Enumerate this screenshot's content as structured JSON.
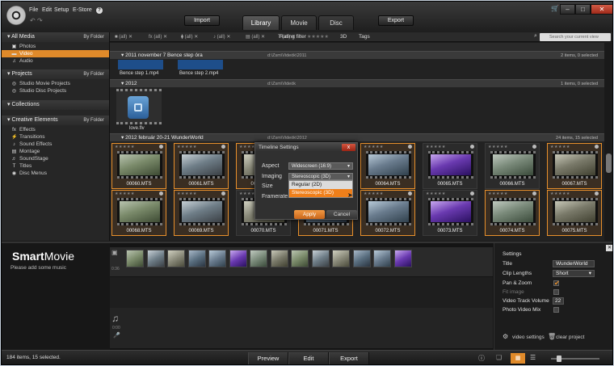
{
  "menu": [
    "File",
    "Edit",
    "Setup",
    "E-Store"
  ],
  "help_icon": "?",
  "toolbar": {
    "import": "Import",
    "export": "Export"
  },
  "tabs": [
    {
      "label": "Library",
      "active": true
    },
    {
      "label": "Movie",
      "active": false
    },
    {
      "label": "Disc",
      "active": false
    }
  ],
  "window_buttons": [
    "minimize",
    "maximize",
    "close"
  ],
  "filters": {
    "chips": [
      "(all)",
      "(all)",
      "(all)",
      "(all)",
      "(all)",
      "(all)"
    ],
    "rating_filter": "Rating filter",
    "rating_stars": "★★★★★",
    "three_d": "3D",
    "tags": "Tags",
    "search_placeholder": "Search your current view"
  },
  "sidebar": {
    "all_media": {
      "title": "All Media",
      "sort": "By Folder",
      "items": [
        "Photos",
        "Video",
        "Audio"
      ],
      "selected": "Video"
    },
    "projects": {
      "title": "Projects",
      "sort": "By Folder",
      "items": [
        "Studio Movie Projects",
        "Studio Disc Projects"
      ]
    },
    "collections": {
      "title": "Collections"
    },
    "creative": {
      "title": "Creative Elements",
      "sort": "By Folder",
      "items": [
        "Effects",
        "Transitions",
        "Sound Effects",
        "Montage",
        "SoundStage",
        "Titles",
        "Disc Menus"
      ]
    }
  },
  "groups": [
    {
      "title": "2011 november 7 Bence step óra",
      "path": "d:\\Zsm\\Videók\\2011",
      "count": "2 items, 0 selected",
      "items": [
        "Bence step 1.mp4",
        "Bence step 2.mp4"
      ]
    },
    {
      "title": "2012",
      "path": "d:\\Zsm\\Videók",
      "count": "1 items, 0 selected",
      "items": [
        "love.flv"
      ]
    },
    {
      "title": "2012 február 20-21 WunderWorld",
      "path": "d:\\Zsm\\Videók\\2012",
      "count": "24 items, 15 selected",
      "row1": [
        {
          "name": "00060.MTS",
          "sel": true
        },
        {
          "name": "00061.MTS",
          "sel": true
        },
        {
          "name": "00062.MTS",
          "sel": true
        },
        {
          "name": "00063.MTS",
          "sel": false
        },
        {
          "name": "00064.MTS",
          "sel": true
        },
        {
          "name": "00065.MTS",
          "sel": false
        },
        {
          "name": "00066.MTS",
          "sel": false
        },
        {
          "name": "00067.MTS",
          "sel": true
        }
      ],
      "row2": [
        {
          "name": "00068.MTS",
          "sel": true
        },
        {
          "name": "00069.MTS",
          "sel": true
        },
        {
          "name": "00070.MTS",
          "sel": false
        },
        {
          "name": "00071.MTS",
          "sel": true
        },
        {
          "name": "00072.MTS",
          "sel": true
        },
        {
          "name": "00073.MTS",
          "sel": false
        },
        {
          "name": "00074.MTS",
          "sel": true
        },
        {
          "name": "00075.MTS",
          "sel": true
        }
      ]
    }
  ],
  "dialog": {
    "title": "Timeline Settings",
    "close": "x",
    "aspect_label": "Aspect",
    "aspect_value": "Widescreen (16:9)",
    "imaging_label": "Imaging",
    "imaging_value": "Stereoscopic (3D)",
    "size_label": "Size",
    "framerate_label": "Framerate",
    "options": [
      "Regular (2D)",
      "Stereoscopic (3D)"
    ],
    "apply": "Apply",
    "cancel": "Cancel"
  },
  "smartmovie": {
    "title_bold": "Smart",
    "title_rest": "Movie",
    "hint": "Please add some music",
    "clip_label": "0:36",
    "audio_label": "0:00"
  },
  "settings": {
    "header": "Settings",
    "title_label": "Title",
    "title_value": "WunderWorld",
    "clip_lengths_label": "Clip Lengths",
    "clip_lengths_value": "Short",
    "pan_zoom_label": "Pan & Zoom",
    "fit_image_label": "Fit image",
    "volume_label": "Video Track Volume",
    "volume_value": "22",
    "photo_mix_label": "Photo Video Mix",
    "video_settings": "video settings",
    "clear_project": "clear project"
  },
  "status": "184 items, 15 selected.",
  "bottom": {
    "preview": "Preview",
    "edit": "Edit",
    "export": "Export"
  },
  "colors": {
    "accent": "#e08a2a",
    "selected_border": "#e8902c",
    "close_red": "#c23a24"
  }
}
